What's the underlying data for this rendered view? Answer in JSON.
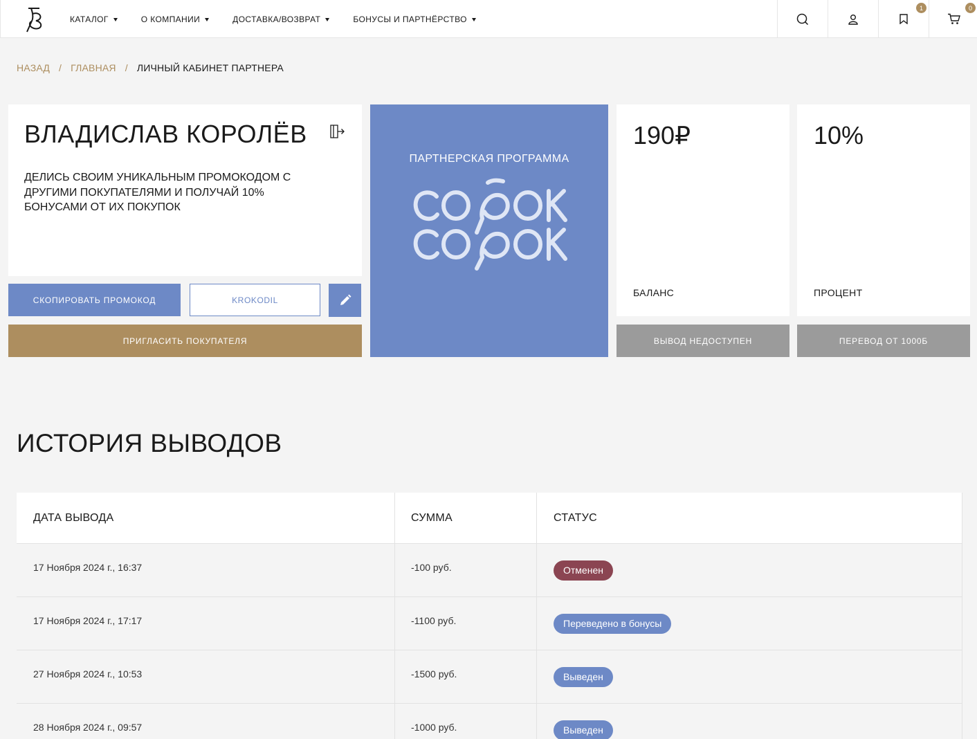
{
  "header": {
    "nav": [
      {
        "label": "КАТАЛОГ"
      },
      {
        "label": "О КОМПАНИИ"
      },
      {
        "label": "ДОСТАВКА/ВОЗВРАТ"
      },
      {
        "label": "БОНУСЫ И ПАРТНЁРСТВО"
      }
    ],
    "icons": {
      "search": "search-icon",
      "user": "user-icon",
      "bookmark": "bookmark-icon",
      "cart": "cart-icon"
    },
    "bookmark_count": "1",
    "cart_count": "0"
  },
  "breadcrumb": {
    "back": "НАЗАД",
    "sep1": "/",
    "home": "ГЛАВНАЯ",
    "sep2": "/",
    "current": "ЛИЧНЫЙ КАБИНЕТ ПАРТНЕРА"
  },
  "profile": {
    "name": "ВЛАДИСЛАВ КОРОЛЁВ",
    "description": "ДЕЛИСЬ СВОИМ УНИКАЛЬНЫМ ПРОМОКОДОМ С ДРУГИМИ ПОКУПАТЕЛЯМИ И ПОЛУЧАЙ 10% БОНУСАМИ ОТ ИХ ПОКУПОК",
    "copy_button": "СКОПИРОВАТЬ ПРОМОКОД",
    "promo_code": "KROKODIL",
    "invite_button": "ПРИГЛАСИТЬ ПОКУПАТЕЛЯ"
  },
  "program": {
    "title": "ПАРТНЕРСКАЯ ПРОГРАММА",
    "logo_text": "СОРОК СОРОК"
  },
  "balance": {
    "value": "190₽",
    "label": "БАЛАНС",
    "button": "ВЫВОД НЕДОСТУПЕН"
  },
  "percent": {
    "value": "10%",
    "label": "ПРОЦЕНТ",
    "button": "ПЕРЕВОД ОТ 1000Б"
  },
  "history": {
    "title": "ИСТОРИЯ ВЫВОДОВ",
    "columns": [
      "ДАТА ВЫВОДА",
      "СУММА",
      "СТАТУС"
    ],
    "rows": [
      {
        "date": "17 Ноября 2024 г., 16:37",
        "amount": "-100 руб.",
        "status": "Отменен"
      },
      {
        "date": "17 Ноября 2024 г., 17:17",
        "amount": "-1100 руб.",
        "status": "Переведено в бонусы"
      },
      {
        "date": "27 Ноября 2024 г., 10:53",
        "amount": "-1500 руб.",
        "status": "Выведен"
      },
      {
        "date": "28 Ноября 2024 г., 09:57",
        "amount": "-1000 руб.",
        "status": "Выведен"
      }
    ]
  },
  "colors": {
    "accent_blue": "#6d89c6",
    "gold": "#ad8e5f",
    "gray_button": "#9b9b9b",
    "cancel_badge": "#8b4552"
  }
}
